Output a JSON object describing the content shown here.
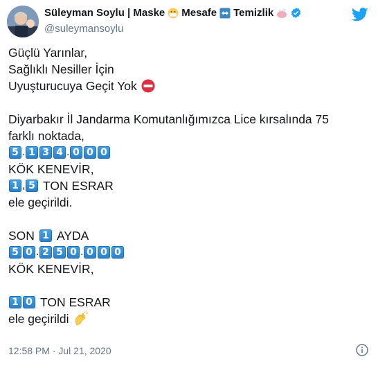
{
  "author": {
    "name": "Süleyman Soylu | Maske",
    "name_mid": "Mesafe",
    "name_end": "Temizlik",
    "handle": "@suleymansoylu",
    "name_emojis": [
      "face-with-mask-icon",
      "left-right-arrow-icon",
      "soap-icon"
    ],
    "verified_icon": "verified-badge-icon",
    "brand_icon": "twitter-bird-icon",
    "brand_color": "#1da1f2"
  },
  "tweet": {
    "l1": "Güçlü Yarınlar,",
    "l2": "Sağlıklı Nesiller İçin",
    "l3": "Uyuşturucuya Geçit Yok",
    "l4": "Diyarbakır İl Jandarma Komutanlığımızca Lice kırsalında 75",
    "l5": "farklı noktada,",
    "n1": [
      "5",
      "1",
      "3",
      "4",
      "0",
      "0",
      "0"
    ],
    "l7": "KÖK KENEVİR,",
    "n2a": "1",
    "n2b": "5",
    "l8": "TON ESRAR",
    "l9": "ele geçirildi.",
    "l10a": "SON",
    "n3": "1",
    "l10b": "AYDA",
    "n4": [
      "5",
      "0",
      "2",
      "5",
      "0",
      "0",
      "0",
      "0"
    ],
    "l12": "KÖK KENEVİR,",
    "n5": [
      "1",
      "0"
    ],
    "l13": "TON ESRAR",
    "l14": "ele geçirildi"
  },
  "footer": {
    "timestamp": "12:58 PM · Jul 21, 2020",
    "info_icon": "info-icon"
  },
  "keycap_color": "#2a7fc9"
}
